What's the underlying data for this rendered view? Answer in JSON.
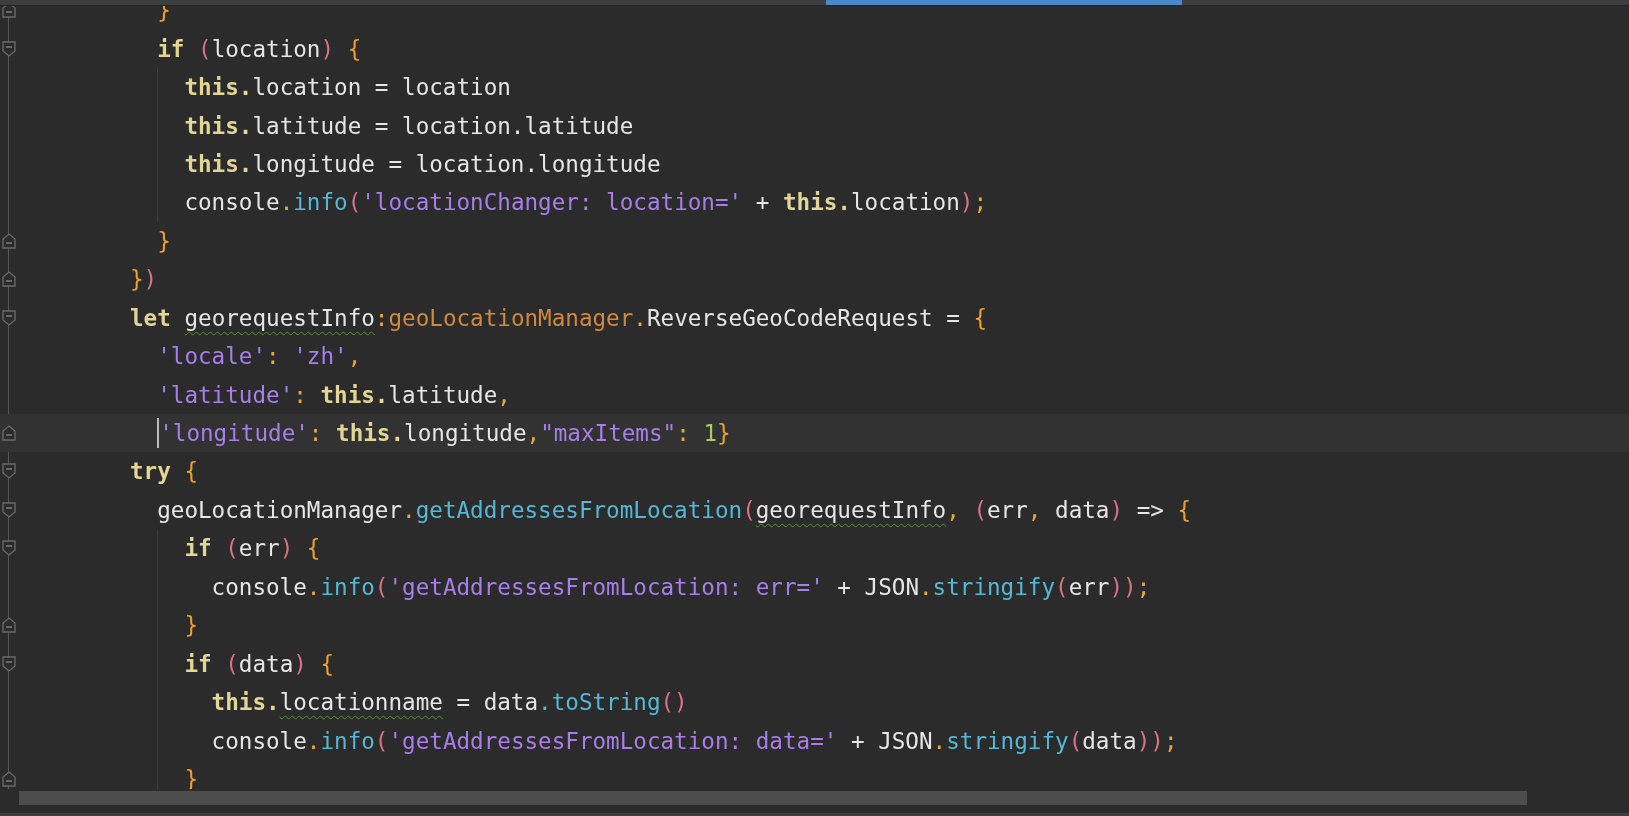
{
  "editor": {
    "lines": [
      {
        "children": [
          {
            "kind": "closer",
            "current": false,
            "tokens": [
              {
                "kind": "brace",
                "text": "}"
              }
            ]
          },
          {
            "kind": "opener",
            "current": false,
            "tokens": [
              {
                "kind": "keyword",
                "text": "if"
              },
              {
                "kind": "paren",
                "text": " ("
              },
              {
                "kind": "plain",
                "text": "location"
              },
              {
                "kind": "paren",
                "text": ")"
              },
              {
                "kind": "brace",
                "text": " {"
              }
            ],
            "children": [
              {
                "current": false,
                "tokens": [
                  {
                    "kind": "keyword",
                    "text": "this."
                  },
                  {
                    "kind": "plain",
                    "text": "location = location"
                  }
                ]
              },
              {
                "current": false,
                "tokens": [
                  {
                    "kind": "keyword",
                    "text": "this."
                  },
                  {
                    "kind": "plain",
                    "text": "latitude = location.latitude"
                  }
                ]
              },
              {
                "current": false,
                "tokens": [
                  {
                    "kind": "keyword",
                    "text": "this."
                  },
                  {
                    "kind": "plain",
                    "text": "longitude = location.longitude"
                  }
                ]
              },
              {
                "current": false,
                "tokens": [
                  {
                    "kind": "plain",
                    "text": "console"
                  },
                  {
                    "kind": "dot",
                    "text": "."
                  },
                  {
                    "kind": "method",
                    "text": "info"
                  },
                  {
                    "kind": "paren",
                    "text": "("
                  },
                  {
                    "kind": "string",
                    "text": "'locationChanger: location='"
                  },
                  {
                    "kind": "plain",
                    "text": " + "
                  },
                  {
                    "kind": "keyword",
                    "text": "this."
                  },
                  {
                    "kind": "plain",
                    "text": "location"
                  },
                  {
                    "kind": "paren",
                    "text": ")"
                  },
                  {
                    "kind": "dot",
                    "text": ";"
                  }
                ]
              }
            ]
          },
          {
            "kind": "closer",
            "current": false,
            "tokens": [
              {
                "kind": "brace",
                "text": "}"
              }
            ]
          }
        ]
      },
      {
        "kind": "closer",
        "current": false,
        "tokens": [
          {
            "kind": "brace",
            "text": "}"
          },
          {
            "kind": "paren",
            "text": ")"
          }
        ]
      },
      {
        "kind": "opener",
        "current": false,
        "tokens": [
          {
            "kind": "keyword",
            "text": "let "
          },
          {
            "kind": "plain",
            "text": "georequestInfo",
            "warning": true
          },
          {
            "kind": "dot",
            "text": ":"
          },
          {
            "kind": "type",
            "text": "geoLocationManager"
          },
          {
            "kind": "dot",
            "text": "."
          },
          {
            "kind": "plain",
            "text": "ReverseGeoCodeRequest = "
          },
          {
            "kind": "brace",
            "text": "{"
          }
        ],
        "children": [
          {
            "current": false,
            "tokens": [
              {
                "kind": "string",
                "text": "'locale'"
              },
              {
                "kind": "dot",
                "text": ": "
              },
              {
                "kind": "string",
                "text": "'zh'"
              },
              {
                "kind": "dot",
                "text": ","
              }
            ]
          },
          {
            "current": false,
            "tokens": [
              {
                "kind": "string",
                "text": "'latitude'"
              },
              {
                "kind": "dot",
                "text": ": "
              },
              {
                "kind": "keyword",
                "text": "this."
              },
              {
                "kind": "plain",
                "text": "latitude"
              },
              {
                "kind": "dot",
                "text": ","
              }
            ]
          },
          {
            "kind": "closer",
            "current": true,
            "tokens": [
              {
                "kind": "string",
                "text": "'longitude'"
              },
              {
                "kind": "dot",
                "text": ": "
              },
              {
                "kind": "keyword",
                "text": "this."
              },
              {
                "kind": "plain",
                "text": "longitude"
              },
              {
                "kind": "dot",
                "text": ","
              },
              {
                "kind": "string",
                "text": "\"maxItems\""
              },
              {
                "kind": "dot",
                "text": ": "
              },
              {
                "kind": "number",
                "text": "1"
              },
              {
                "kind": "brace",
                "text": "}"
              }
            ]
          }
        ]
      },
      {
        "kind": "opener",
        "current": false,
        "tokens": [
          {
            "kind": "keyword",
            "text": "try"
          },
          {
            "kind": "brace",
            "text": " {"
          }
        ],
        "children": [
          {
            "kind": "opener",
            "current": false,
            "tokens": [
              {
                "kind": "plain",
                "text": "geoLocationManager"
              },
              {
                "kind": "dot",
                "text": "."
              },
              {
                "kind": "method",
                "text": "getAddressesFromLocation"
              },
              {
                "kind": "paren",
                "text": "("
              },
              {
                "kind": "plain",
                "text": "georequestInfo",
                "warning": true
              },
              {
                "kind": "dot",
                "text": ", "
              },
              {
                "kind": "paren",
                "text": "("
              },
              {
                "kind": "plain",
                "text": "err"
              },
              {
                "kind": "dot",
                "text": ", "
              },
              {
                "kind": "plain",
                "text": "data"
              },
              {
                "kind": "paren",
                "text": ")"
              },
              {
                "kind": "plain",
                "text": " => "
              },
              {
                "kind": "brace",
                "text": "{"
              }
            ],
            "children": [
              {
                "kind": "opener",
                "current": false,
                "tokens": [
                  {
                    "kind": "keyword",
                    "text": "if"
                  },
                  {
                    "kind": "paren",
                    "text": " ("
                  },
                  {
                    "kind": "plain",
                    "text": "err"
                  },
                  {
                    "kind": "paren",
                    "text": ")"
                  },
                  {
                    "kind": "brace",
                    "text": " {"
                  }
                ],
                "children": [
                  {
                    "current": false,
                    "tokens": [
                      {
                        "kind": "plain",
                        "text": "console"
                      },
                      {
                        "kind": "dot",
                        "text": "."
                      },
                      {
                        "kind": "method",
                        "text": "info"
                      },
                      {
                        "kind": "paren",
                        "text": "("
                      },
                      {
                        "kind": "string",
                        "text": "'getAddressesFromLocation: err='"
                      },
                      {
                        "kind": "plain",
                        "text": " + JSON"
                      },
                      {
                        "kind": "dot",
                        "text": "."
                      },
                      {
                        "kind": "method",
                        "text": "stringify"
                      },
                      {
                        "kind": "paren",
                        "text": "("
                      },
                      {
                        "kind": "plain",
                        "text": "err"
                      },
                      {
                        "kind": "paren",
                        "text": "))"
                      },
                      {
                        "kind": "dot",
                        "text": ";"
                      }
                    ]
                  }
                ]
              },
              {
                "kind": "closer",
                "current": false,
                "tokens": [
                  {
                    "kind": "brace",
                    "text": "}"
                  }
                ]
              },
              {
                "kind": "opener",
                "current": false,
                "tokens": [
                  {
                    "kind": "keyword",
                    "text": "if"
                  },
                  {
                    "kind": "paren",
                    "text": " ("
                  },
                  {
                    "kind": "plain",
                    "text": "data"
                  },
                  {
                    "kind": "paren",
                    "text": ")"
                  },
                  {
                    "kind": "brace",
                    "text": " {"
                  }
                ],
                "children": [
                  {
                    "current": false,
                    "tokens": [
                      {
                        "kind": "keyword",
                        "text": "this."
                      },
                      {
                        "kind": "plain",
                        "text": "locationname",
                        "warning": true
                      },
                      {
                        "kind": "plain",
                        "text": " = data"
                      },
                      {
                        "kind": "method",
                        "text": ".toString"
                      },
                      {
                        "kind": "paren",
                        "text": "()"
                      }
                    ]
                  },
                  {
                    "current": false,
                    "tokens": [
                      {
                        "kind": "plain",
                        "text": "console"
                      },
                      {
                        "kind": "dot",
                        "text": "."
                      },
                      {
                        "kind": "method",
                        "text": "info"
                      },
                      {
                        "kind": "paren",
                        "text": "("
                      },
                      {
                        "kind": "string",
                        "text": "'getAddressesFromLocation: data='"
                      },
                      {
                        "kind": "plain",
                        "text": " + JSON"
                      },
                      {
                        "kind": "dot",
                        "text": "."
                      },
                      {
                        "kind": "method",
                        "text": "stringify"
                      },
                      {
                        "kind": "paren",
                        "text": "("
                      },
                      {
                        "kind": "plain",
                        "text": "data"
                      },
                      {
                        "kind": "paren",
                        "text": "))"
                      },
                      {
                        "kind": "dot",
                        "text": ";"
                      }
                    ]
                  }
                ]
              },
              {
                "kind": "closer",
                "current": false,
                "tokens": [
                  {
                    "kind": "brace",
                    "text": "}"
                  }
                ]
              }
            ]
          }
        ]
      }
    ]
  }
}
